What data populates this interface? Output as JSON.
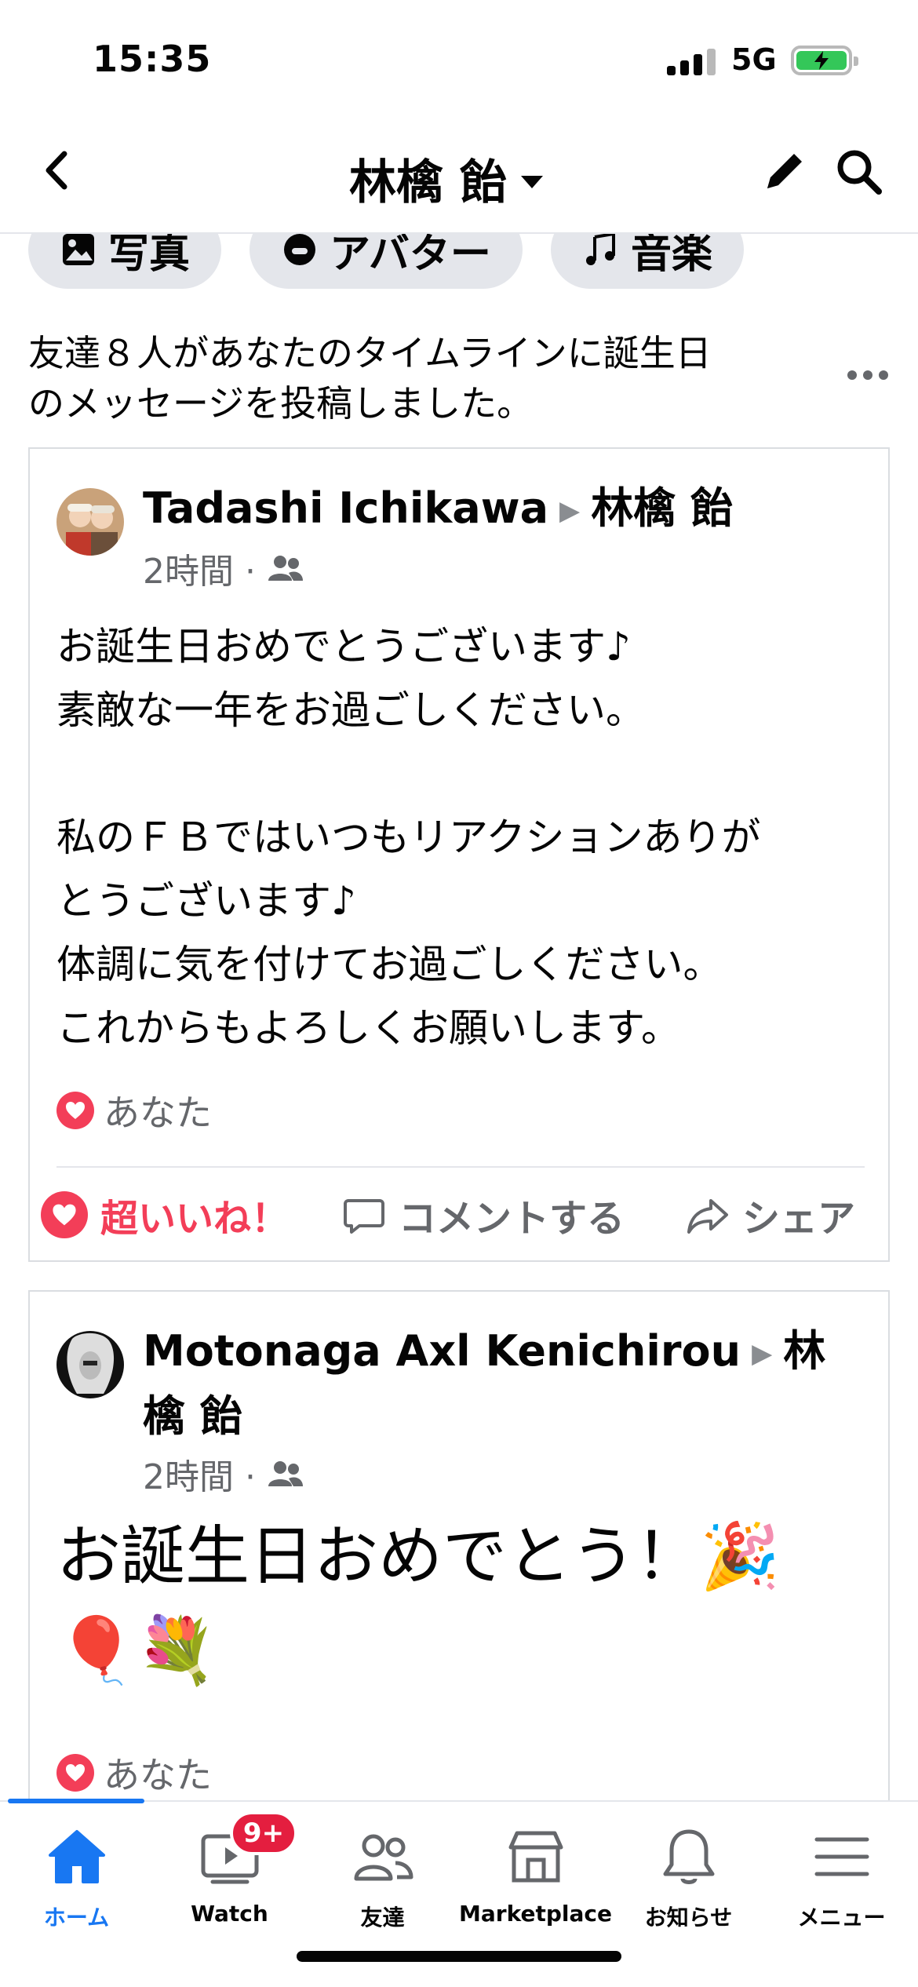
{
  "status_bar": {
    "time": "15:35",
    "network": "5G"
  },
  "nav": {
    "title": "林檎 飴"
  },
  "chips": [
    {
      "label": "写真",
      "icon": "photo-icon"
    },
    {
      "label": "アバター",
      "icon": "avatar-icon"
    },
    {
      "label": "音楽",
      "icon": "music-icon"
    }
  ],
  "summary": {
    "text": "友達８人があなたのタイムラインに誕生日\nのメッセージを投稿しました。"
  },
  "posts": [
    {
      "author": "Tadashi Ichikawa",
      "target": "林檎 飴",
      "time": "2時間 ·",
      "text": "お誕生日おめでとうございます♪\n素敵な一年をお過ごしください。\n\n私のＦＢではいつもリアクションありが\nとうございます♪\n体調に気を付けてお過ごしください。\nこれからもよろしくお願いします。",
      "reaction_text": "あなた",
      "actions": {
        "love": "超いいね！",
        "comment": "コメントする",
        "share": "シェア"
      }
    },
    {
      "author": "Motonaga Axl Kenichirou",
      "target": "林檎 飴",
      "time": "2時間 ·",
      "text": "お誕生日おめでとう！🎉\n🎈💐",
      "reaction_text": "あなた"
    }
  ],
  "tabbar": {
    "active": "home",
    "items": [
      {
        "label": "ホーム",
        "icon": "home-icon"
      },
      {
        "label": "Watch",
        "icon": "watch-icon",
        "badge": "9+"
      },
      {
        "label": "友達",
        "icon": "friends-icon"
      },
      {
        "label": "Marketplace",
        "icon": "marketplace-icon"
      },
      {
        "label": "お知らせ",
        "icon": "bell-icon"
      },
      {
        "label": "メニュー",
        "icon": "menu-icon"
      }
    ]
  },
  "colors": {
    "accent": "#1877f2",
    "love": "#f33e58",
    "secondary_text": "#65676b",
    "chip_bg": "#e4e6eb",
    "badge": "#e41e3f",
    "battery": "#34c759"
  }
}
